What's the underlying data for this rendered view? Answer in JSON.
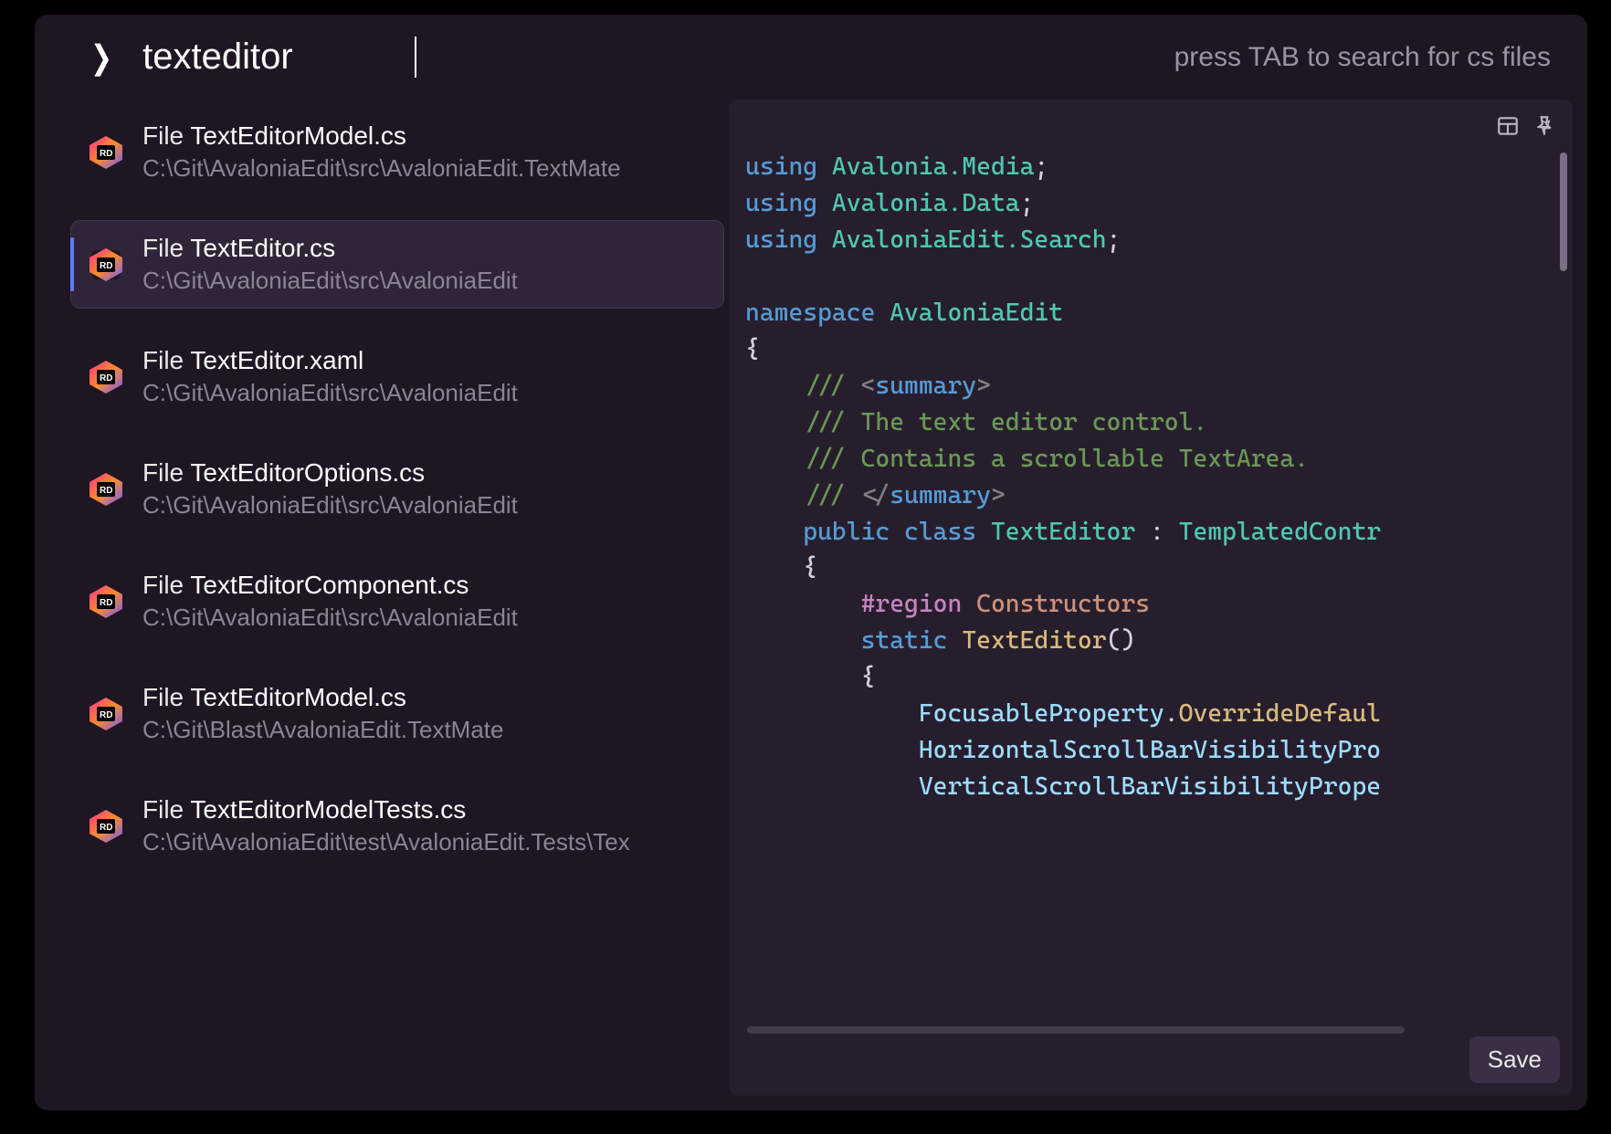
{
  "search": {
    "query": "texteditor",
    "hint": "press TAB to search for cs files"
  },
  "results": [
    {
      "prefix": "File ",
      "name": "TextEditorModel.cs",
      "path": "C:\\Git\\AvaloniaEdit\\src\\AvaloniaEdit.TextMate",
      "selected": false
    },
    {
      "prefix": "File ",
      "name": "TextEditor.cs",
      "path": "C:\\Git\\AvaloniaEdit\\src\\AvaloniaEdit",
      "selected": true
    },
    {
      "prefix": "File ",
      "name": "TextEditor.xaml",
      "path": "C:\\Git\\AvaloniaEdit\\src\\AvaloniaEdit",
      "selected": false
    },
    {
      "prefix": "File ",
      "name": "TextEditorOptions.cs",
      "path": "C:\\Git\\AvaloniaEdit\\src\\AvaloniaEdit",
      "selected": false
    },
    {
      "prefix": "File ",
      "name": "TextEditorComponent.cs",
      "path": "C:\\Git\\AvaloniaEdit\\src\\AvaloniaEdit",
      "selected": false
    },
    {
      "prefix": "File ",
      "name": "TextEditorModel.cs",
      "path": "C:\\Git\\Blast\\AvaloniaEdit.TextMate",
      "selected": false
    },
    {
      "prefix": "File ",
      "name": "TextEditorModelTests.cs",
      "path": "C:\\Git\\AvaloniaEdit\\test\\AvaloniaEdit.Tests\\Tex",
      "selected": false
    }
  ],
  "preview": {
    "save_label": "Save",
    "code_lines": [
      [
        {
          "t": "using ",
          "c": "kw"
        },
        {
          "t": "Avalonia.Media",
          "c": "ns"
        },
        {
          "t": ";",
          "c": "punct"
        }
      ],
      [
        {
          "t": "using ",
          "c": "kw"
        },
        {
          "t": "Avalonia.Data",
          "c": "ns"
        },
        {
          "t": ";",
          "c": "punct"
        }
      ],
      [
        {
          "t": "using ",
          "c": "kw"
        },
        {
          "t": "AvaloniaEdit.Search",
          "c": "ns"
        },
        {
          "t": ";",
          "c": "punct"
        }
      ],
      [
        {
          "t": "",
          "c": ""
        }
      ],
      [
        {
          "t": "namespace ",
          "c": "kw"
        },
        {
          "t": "AvaloniaEdit",
          "c": "ns"
        }
      ],
      [
        {
          "t": "{",
          "c": "punct"
        }
      ],
      [
        {
          "t": "    /// ",
          "c": "comment"
        },
        {
          "t": "<",
          "c": "tag"
        },
        {
          "t": "summary",
          "c": "tagname"
        },
        {
          "t": ">",
          "c": "tag"
        }
      ],
      [
        {
          "t": "    /// The text editor control.",
          "c": "comment"
        }
      ],
      [
        {
          "t": "    /// Contains a scrollable TextArea.",
          "c": "comment"
        }
      ],
      [
        {
          "t": "    /// ",
          "c": "comment"
        },
        {
          "t": "</",
          "c": "tag"
        },
        {
          "t": "summary",
          "c": "tagname"
        },
        {
          "t": ">",
          "c": "tag"
        }
      ],
      [
        {
          "t": "    public class ",
          "c": "kw"
        },
        {
          "t": "TextEditor",
          "c": "type"
        },
        {
          "t": " : ",
          "c": "punct"
        },
        {
          "t": "TemplatedContr",
          "c": "type"
        }
      ],
      [
        {
          "t": "    {",
          "c": "punct"
        }
      ],
      [
        {
          "t": "        #region ",
          "c": "region"
        },
        {
          "t": "Constructors",
          "c": "regionname"
        }
      ],
      [
        {
          "t": "        static ",
          "c": "kw"
        },
        {
          "t": "TextEditor",
          "c": "method"
        },
        {
          "t": "()",
          "c": "punct"
        }
      ],
      [
        {
          "t": "        {",
          "c": "punct"
        }
      ],
      [
        {
          "t": "            ",
          "c": ""
        },
        {
          "t": "FocusableProperty",
          "c": "field"
        },
        {
          "t": ".",
          "c": "punct"
        },
        {
          "t": "OverrideDefaul",
          "c": "method"
        }
      ],
      [
        {
          "t": "            ",
          "c": ""
        },
        {
          "t": "HorizontalScrollBarVisibilityPro",
          "c": "field"
        }
      ],
      [
        {
          "t": "            ",
          "c": ""
        },
        {
          "t": "VerticalScrollBarVisibilityPrope",
          "c": "field"
        }
      ]
    ]
  }
}
